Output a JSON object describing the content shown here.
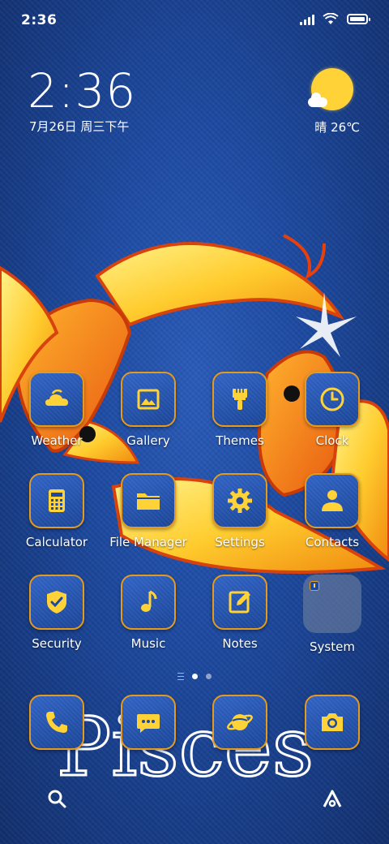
{
  "status_bar": {
    "time": "2:36",
    "icons": [
      "signal-icon",
      "wifi-icon",
      "battery-icon"
    ]
  },
  "clock_widget": {
    "time": "2:36",
    "date": "7月26日 周三下午"
  },
  "weather_widget": {
    "icon": "sunny-cloud-icon",
    "text": "晴 26℃"
  },
  "wallpaper": {
    "caption": "Pisces"
  },
  "apps": [
    {
      "label": "Weather",
      "icon": "weather-icon"
    },
    {
      "label": "Gallery",
      "icon": "gallery-icon"
    },
    {
      "label": "Themes",
      "icon": "brush-icon"
    },
    {
      "label": "Clock",
      "icon": "clock-icon"
    },
    {
      "label": "Calculator",
      "icon": "calculator-icon"
    },
    {
      "label": "File Manager",
      "icon": "folder-icon"
    },
    {
      "label": "Settings",
      "icon": "gear-icon"
    },
    {
      "label": "Contacts",
      "icon": "person-icon"
    },
    {
      "label": "Security",
      "icon": "shield-check-icon"
    },
    {
      "label": "Music",
      "icon": "music-note-icon"
    },
    {
      "label": "Notes",
      "icon": "edit-icon"
    },
    {
      "label": "System",
      "icon": "folder-icon"
    }
  ],
  "page_indicator": {
    "pages": 2,
    "current": 1
  },
  "dock": [
    {
      "icon": "phone-icon"
    },
    {
      "icon": "message-icon"
    },
    {
      "icon": "browser-planet-icon"
    },
    {
      "icon": "camera-icon"
    }
  ],
  "bottom_bar": [
    "search-icon",
    "assistant-icon"
  ],
  "colors": {
    "accent": "#ffd238",
    "icon_border": "#e39a1f",
    "icon_bg": "#1d4aa0",
    "wallpaper": "#1b4597"
  }
}
